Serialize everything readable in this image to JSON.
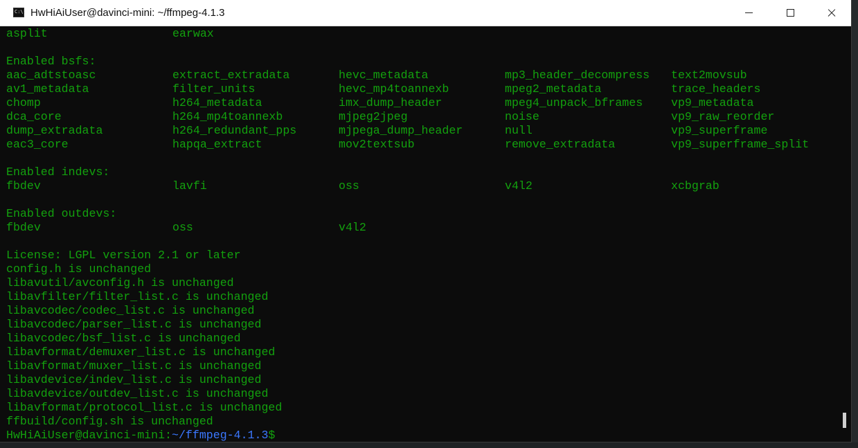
{
  "window": {
    "title": "HwHiAiUser@davinci-mini: ~/ffmpeg-4.1.3",
    "icon_glyph": "C:\\."
  },
  "colors": {
    "terminal_bg": "#0c0c0c",
    "terminal_fg": "#13a10e",
    "path_blue": "#3b78ff"
  },
  "icons": {
    "app": "console-icon",
    "minimize": "minimize-icon",
    "maximize": "maximize-icon",
    "close": "close-icon"
  },
  "terminal": {
    "top_row": [
      "asplit",
      "earwax"
    ],
    "bsfs_header": "Enabled bsfs:",
    "bsfs_rows": [
      [
        "aac_adtstoasc",
        "extract_extradata",
        "hevc_metadata",
        "mp3_header_decompress",
        "text2movsub"
      ],
      [
        "av1_metadata",
        "filter_units",
        "hevc_mp4toannexb",
        "mpeg2_metadata",
        "trace_headers"
      ],
      [
        "chomp",
        "h264_metadata",
        "imx_dump_header",
        "mpeg4_unpack_bframes",
        "vp9_metadata"
      ],
      [
        "dca_core",
        "h264_mp4toannexb",
        "mjpeg2jpeg",
        "noise",
        "vp9_raw_reorder"
      ],
      [
        "dump_extradata",
        "h264_redundant_pps",
        "mjpega_dump_header",
        "null",
        "vp9_superframe"
      ],
      [
        "eac3_core",
        "hapqa_extract",
        "mov2textsub",
        "remove_extradata",
        "vp9_superframe_split"
      ]
    ],
    "indevs_header": "Enabled indevs:",
    "indevs_row": [
      "fbdev",
      "lavfi",
      "oss",
      "v4l2",
      "xcbgrab"
    ],
    "outdevs_header": "Enabled outdevs:",
    "outdevs_row": [
      "fbdev",
      "oss",
      "v4l2"
    ],
    "log_lines": [
      "License: LGPL version 2.1 or later",
      "config.h is unchanged",
      "libavutil/avconfig.h is unchanged",
      "libavfilter/filter_list.c is unchanged",
      "libavcodec/codec_list.c is unchanged",
      "libavcodec/parser_list.c is unchanged",
      "libavcodec/bsf_list.c is unchanged",
      "libavformat/demuxer_list.c is unchanged",
      "libavformat/muxer_list.c is unchanged",
      "libavdevice/indev_list.c is unchanged",
      "libavdevice/outdev_list.c is unchanged",
      "libavformat/protocol_list.c is unchanged",
      "ffbuild/config.sh is unchanged"
    ],
    "prompt": {
      "user_host": "HwHiAiUser@davinci-mini:",
      "path": "~/ffmpeg-4.1.3",
      "suffix": "$"
    }
  }
}
